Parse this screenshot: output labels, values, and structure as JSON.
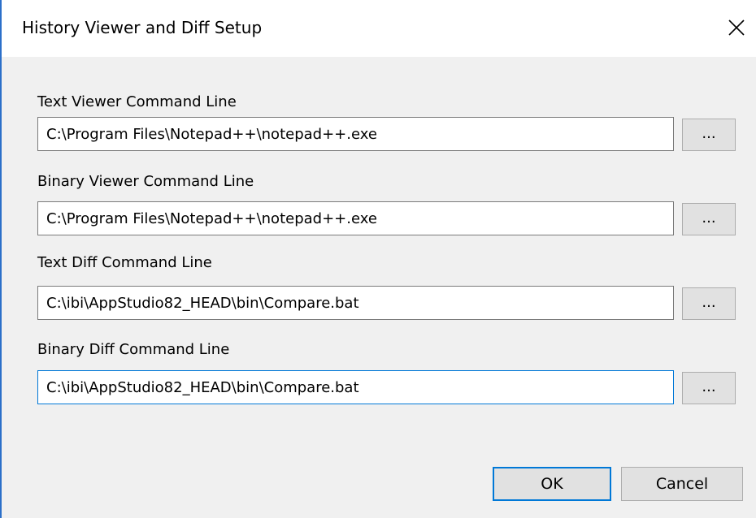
{
  "window": {
    "title": "History Viewer and Diff Setup",
    "close_icon": "close-icon"
  },
  "fields": [
    {
      "label": "Text Viewer Command Line",
      "value": "C:\\Program Files\\Notepad++\\notepad++.exe",
      "browse_label": "..."
    },
    {
      "label": "Binary Viewer Command Line",
      "value": "C:\\Program Files\\Notepad++\\notepad++.exe",
      "browse_label": "..."
    },
    {
      "label": "Text Diff Command Line",
      "value": "C:\\ibi\\AppStudio82_HEAD\\bin\\Compare.bat",
      "browse_label": "..."
    },
    {
      "label": "Binary Diff Command Line",
      "value": "C:\\ibi\\AppStudio82_HEAD\\bin\\Compare.bat",
      "browse_label": "..."
    }
  ],
  "buttons": {
    "ok_label": "OK",
    "cancel_label": "Cancel"
  },
  "colors": {
    "accent": "#0078d7",
    "window_border": "#2b6fc9",
    "dialog_bg": "#f0f0f0"
  }
}
